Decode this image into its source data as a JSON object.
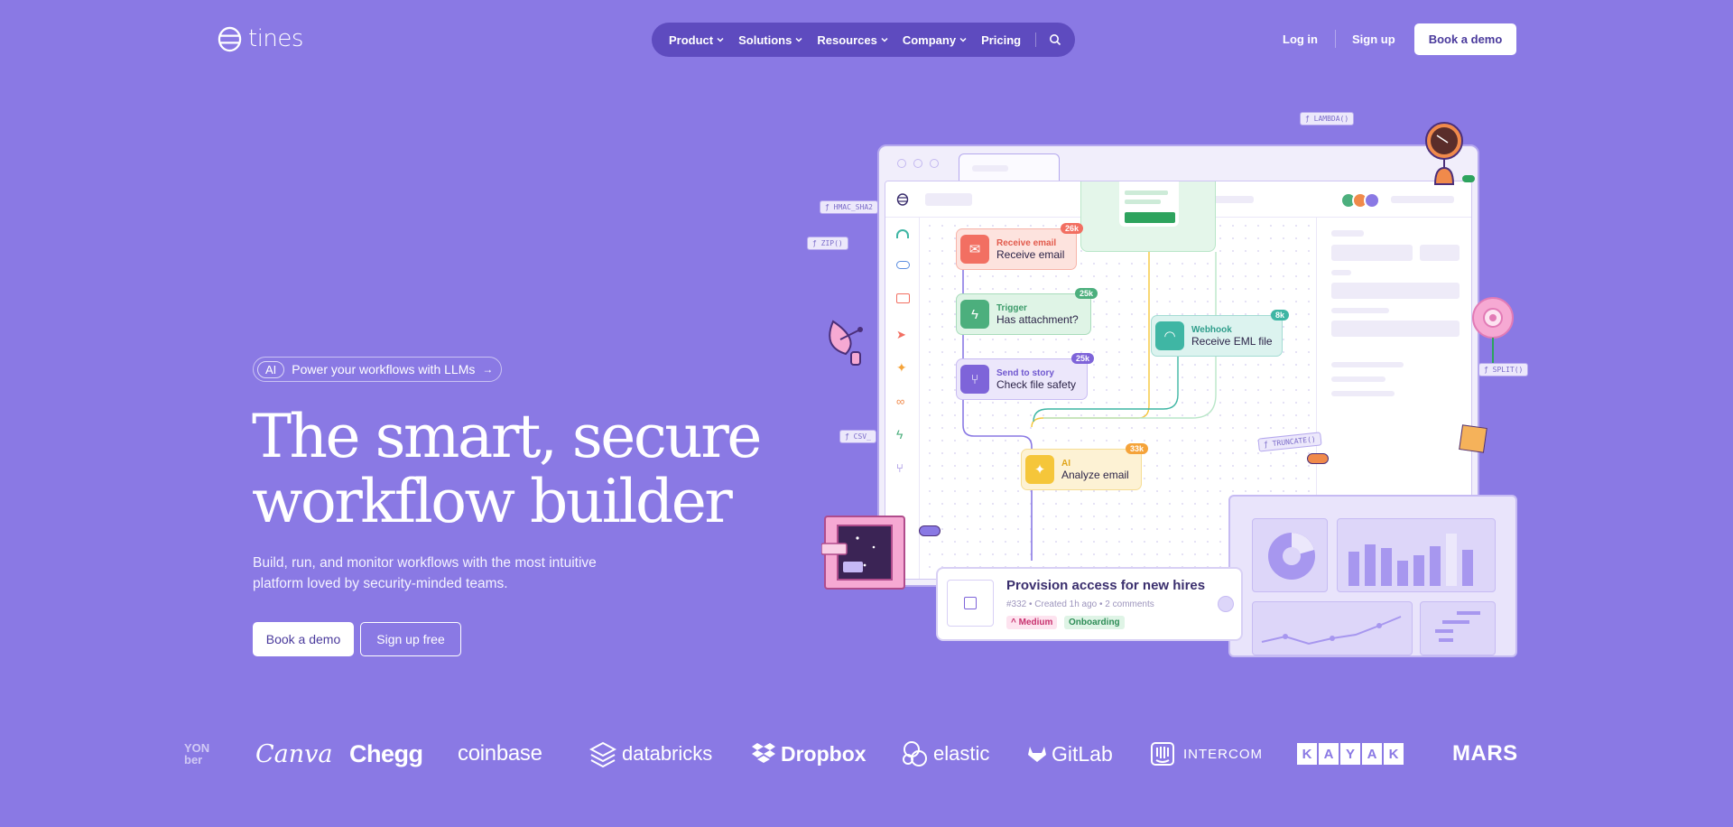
{
  "header": {
    "logo_text": "tines",
    "nav": [
      {
        "label": "Product",
        "dropdown": true
      },
      {
        "label": "Solutions",
        "dropdown": true
      },
      {
        "label": "Resources",
        "dropdown": true
      },
      {
        "label": "Company",
        "dropdown": true
      },
      {
        "label": "Pricing",
        "dropdown": false
      }
    ],
    "login": "Log in",
    "signup": "Sign up",
    "book_demo": "Book a demo"
  },
  "hero": {
    "pill_badge": "AI",
    "pill_text": "Power your workflows with LLMs",
    "pill_arrow": "→",
    "title_line1": "The smart, secure",
    "title_line2": "workflow builder",
    "subtitle_line1": "Build, run, and monitor workflows with the most intuitive",
    "subtitle_line2": "platform loved by security-minded teams.",
    "cta_primary": "Book a demo",
    "cta_secondary": "Sign up free"
  },
  "illustration": {
    "nodes": [
      {
        "kind": "Receive email",
        "title": "Receive email",
        "count": "26k"
      },
      {
        "kind": "Trigger",
        "title": "Has attachment?",
        "count": "25k"
      },
      {
        "kind": "Send to story",
        "title": "Check file safety",
        "count": "25k"
      },
      {
        "kind": "Webhook",
        "title": "Receive EML file",
        "count": "8k"
      },
      {
        "kind": "AI",
        "title": "Analyze email",
        "count": "33k"
      }
    ],
    "fn_chips": {
      "lambda": "LAMBDA()",
      "hmac": "HMAC_SHA2",
      "zip": "ZIP()",
      "csv": "CSV_",
      "truncate": "TRUNCATE()",
      "split": "SPLIT()"
    },
    "card": {
      "title": "Provision access for new hires",
      "meta": "#332 • Created 1h ago • 2 comments",
      "priority": "Medium",
      "tag": "Onboarding"
    }
  },
  "logos": {
    "partial": [
      "YON",
      "ber"
    ],
    "canva": "Canva",
    "chegg": "Chegg",
    "coinbase": "coinbase",
    "databricks": "databricks",
    "dropbox": "Dropbox",
    "elastic": "elastic",
    "gitlab": "GitLab",
    "intercom": "INTERCOM",
    "kayak": [
      "K",
      "A",
      "Y",
      "A",
      "K"
    ],
    "mars": "MARS"
  },
  "colors": {
    "background": "#8a79e4",
    "nav_bg": "#5e4bbf",
    "button_text": "#4a3a9c",
    "node_email": "#f26f62",
    "node_trigger": "#4caf7d",
    "node_story": "#7e64d9",
    "node_webhook": "#3fb6a4",
    "node_ai": "#f5c63a"
  }
}
